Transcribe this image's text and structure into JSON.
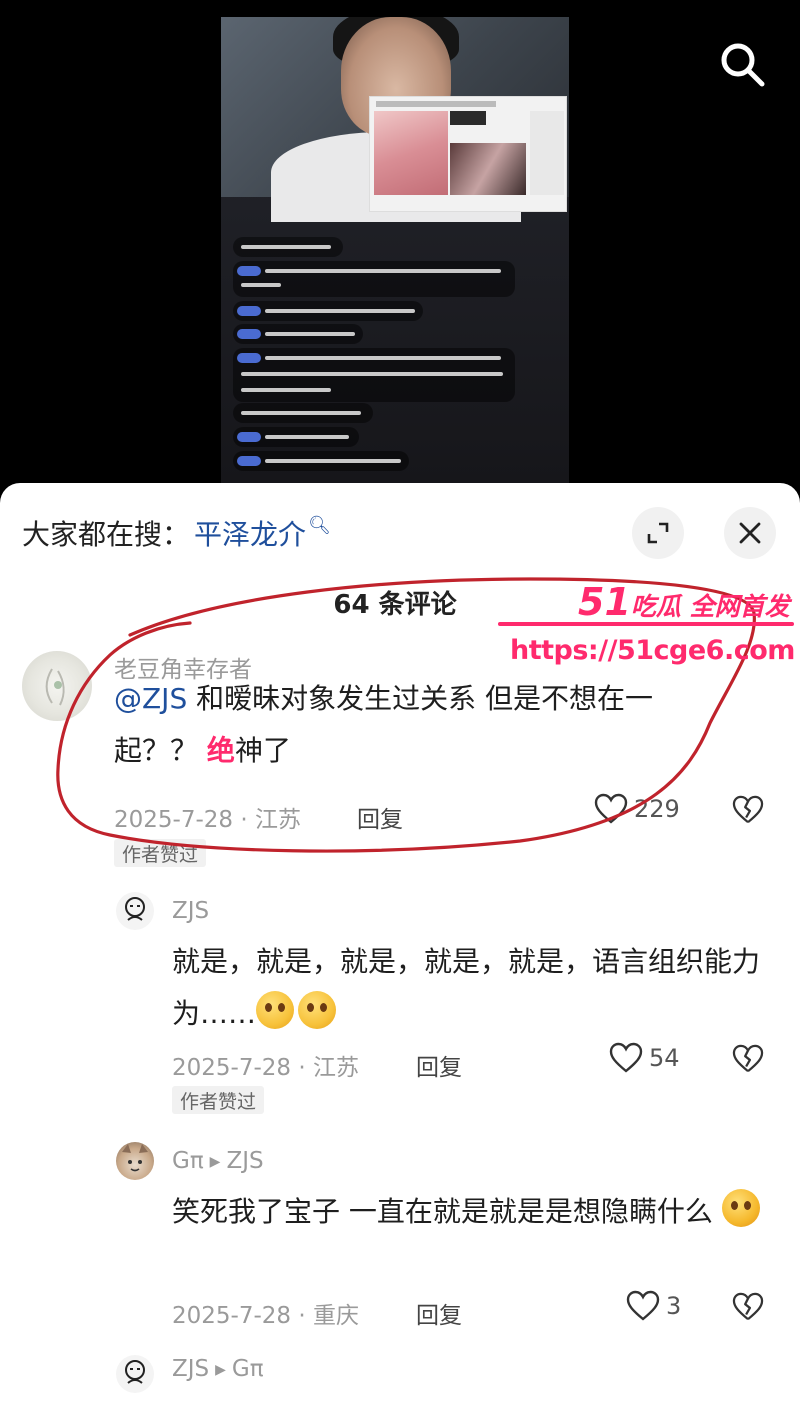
{
  "search_hint": {
    "prefix": "大家都在搜：",
    "term": "平泽龙介"
  },
  "comments_count_label": "64 条评论",
  "watermark": {
    "brand_num": "51",
    "brand_text": "吃瓜 全网首发",
    "url": "https://51cge6.com"
  },
  "comments": [
    {
      "user": "老豆角幸存者",
      "mention": "@ZJS",
      "text": " 和暧昧对象发生过关系 但是不想在一起？？",
      "highlight": "绝",
      "text_after": "神了",
      "date_loc": "2025-7-28 · 江苏",
      "reply_label": "回复",
      "likes": "229",
      "badge": "作者赞过"
    },
    {
      "user": "ZJS",
      "text": "就是，就是，就是，就是，就是，语言组织能力为……",
      "date_loc": "2025-7-28 · 江苏",
      "reply_label": "回复",
      "likes": "54",
      "badge": "作者赞过"
    },
    {
      "user": "Gπ",
      "reply_to": "ZJS",
      "text": "笑死我了宝子 一直在就是就是是想隐瞒什么",
      "date_loc": "2025-7-28 · 重庆",
      "reply_label": "回复",
      "likes": "3"
    },
    {
      "user": "ZJS",
      "reply_to": "Gπ"
    }
  ],
  "colors": {
    "accent_link": "#1f4f9c",
    "watermark": "#ff2a6d",
    "annotation": "#c0232c"
  },
  "icons": [
    "search-icon",
    "expand-icon",
    "close-icon",
    "heart-icon",
    "broken-heart-icon"
  ]
}
